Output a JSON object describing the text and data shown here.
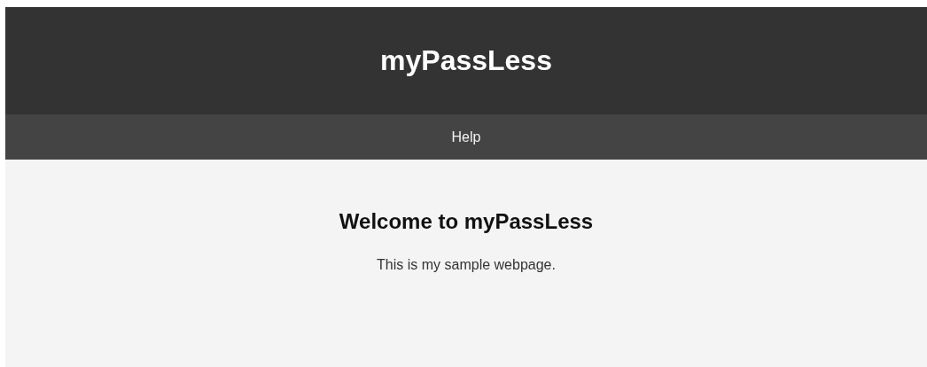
{
  "header": {
    "title": "myPassLess"
  },
  "nav": {
    "items": [
      {
        "label": "Help"
      }
    ]
  },
  "main": {
    "heading": "Welcome to myPassLess",
    "text": "This is my sample webpage."
  }
}
